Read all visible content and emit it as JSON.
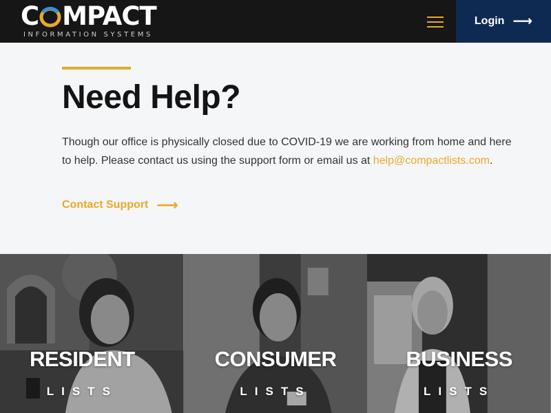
{
  "header": {
    "logo_main_a": "C",
    "logo_main_b": "MPACT",
    "logo_sub": "INFORMATION SYSTEMS",
    "menu_icon": "hamburger-menu-icon",
    "login_label": "Login",
    "login_icon": "arrow-right-icon"
  },
  "help": {
    "title": "Need Help?",
    "text_before": "Though our office is physically closed due to COVID-19 we are working from home and here to help. Please contact us using the support form or email us at ",
    "email": "help@compactlists.com",
    "text_after": ".",
    "contact_label": "Contact Support",
    "contact_icon": "arrow-right-icon"
  },
  "cards": [
    {
      "title": "RESIDENT",
      "subtitle": "LISTS"
    },
    {
      "title": "CONSUMER",
      "subtitle": "LISTS"
    },
    {
      "title": "BUSINESS",
      "subtitle": "LISTS"
    }
  ],
  "colors": {
    "accent": "#e8a927",
    "header_bg": "#161616",
    "login_bg": "#0f2a52",
    "page_bg": "#f5f6f8"
  }
}
